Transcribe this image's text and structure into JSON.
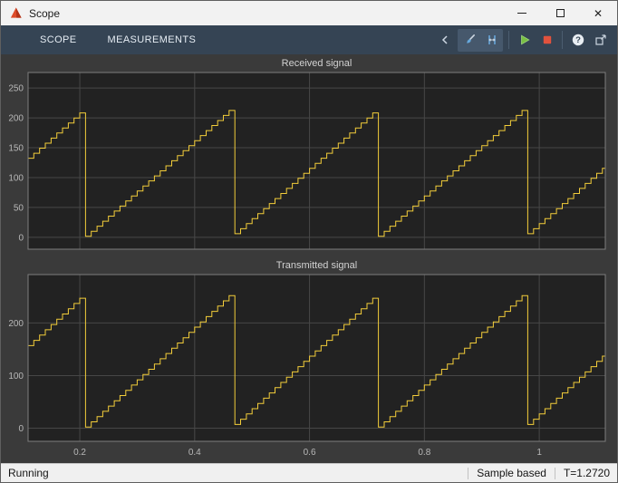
{
  "window": {
    "title": "Scope"
  },
  "toolbar": {
    "tabs": [
      {
        "label": "SCOPE"
      },
      {
        "label": "MEASUREMENTS"
      }
    ],
    "help_glyph": "?",
    "buttons": [
      {
        "name": "collapse-toolstrip"
      },
      {
        "name": "style"
      },
      {
        "name": "cursor-measurements"
      },
      {
        "name": "run"
      },
      {
        "name": "stop"
      },
      {
        "name": "help"
      },
      {
        "name": "dock"
      }
    ]
  },
  "status": {
    "state": "Running",
    "sample_mode": "Sample based",
    "time": "T=1.2720"
  },
  "colors": {
    "line": "#f3cd3a",
    "figure_bg": "#3a3a3a",
    "axes_bg": "#222222",
    "grid": "#474747",
    "axes_border": "#7d7d7d",
    "tick_label": "#b8b8b8",
    "plot_title": "#d2d2d2",
    "toolbar_bg": "#354454",
    "run_green": "#7ac143",
    "stop_red": "#e1523d"
  },
  "chart_data": [
    {
      "type": "line",
      "title": "Received signal",
      "x_range": [
        0.11,
        1.115
      ],
      "y_range": [
        -20,
        276
      ],
      "x_ticks": [
        0.2,
        0.4,
        0.6,
        0.8,
        1
      ],
      "x_tick_labels": [
        "0.2",
        "0.4",
        "0.6",
        "0.8",
        "1"
      ],
      "y_ticks": [
        0,
        50,
        100,
        150,
        200,
        250
      ],
      "grid": true,
      "show_x_tick_labels": false,
      "signal": {
        "shape": "staircase-sawtooth",
        "amplitude": 215,
        "min": 0,
        "period": 0.255,
        "first_reset_time": 0.208,
        "sample_time": 0.01
      }
    },
    {
      "type": "line",
      "title": "Transmitted signal",
      "x_range": [
        0.11,
        1.115
      ],
      "y_range": [
        -25,
        292
      ],
      "x_ticks": [
        0.2,
        0.4,
        0.6,
        0.8,
        1
      ],
      "x_tick_labels": [
        "0.2",
        "0.4",
        "0.6",
        "0.8",
        "1"
      ],
      "y_ticks": [
        0,
        100,
        200
      ],
      "grid": true,
      "show_x_tick_labels": true,
      "signal": {
        "shape": "staircase-sawtooth",
        "amplitude": 255,
        "min": 0,
        "period": 0.255,
        "first_reset_time": 0.208,
        "sample_time": 0.01
      }
    }
  ]
}
